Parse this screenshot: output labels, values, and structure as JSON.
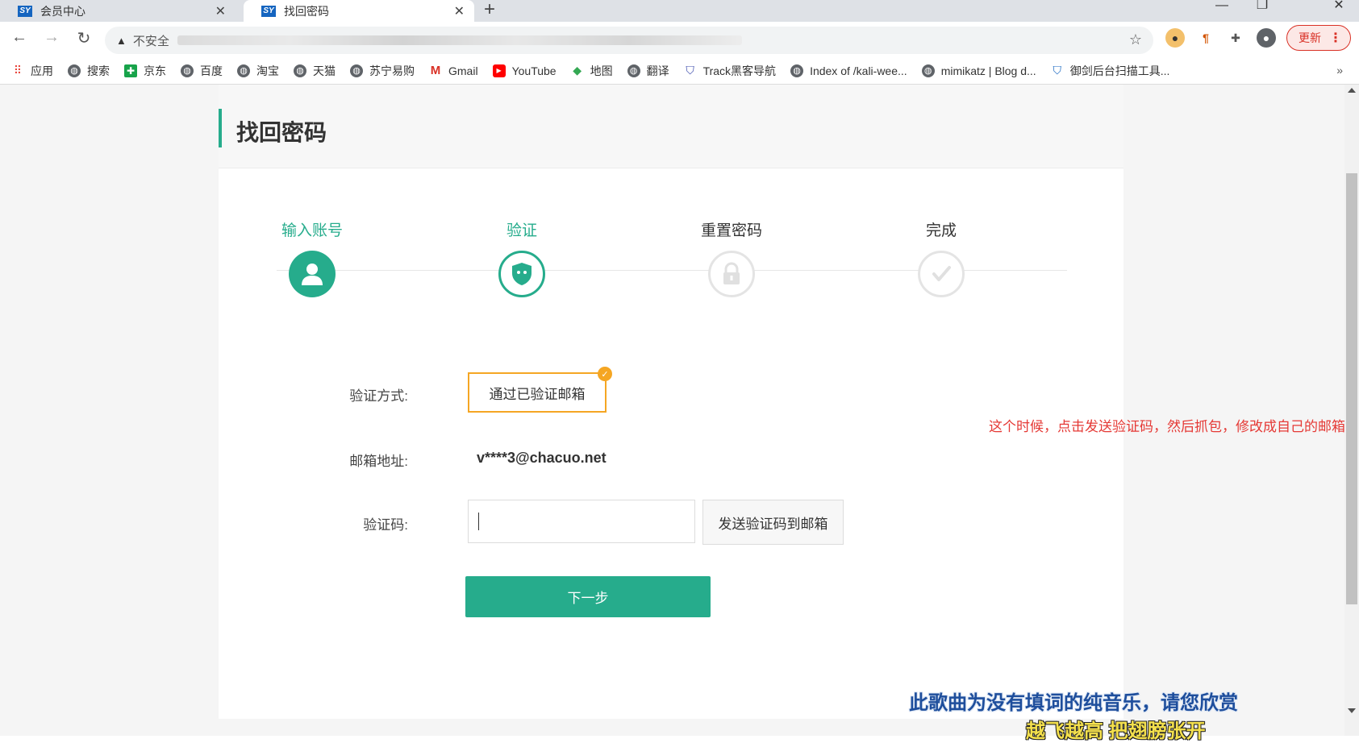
{
  "browser": {
    "tabs": [
      {
        "label": "会员中心",
        "favicon": "SY"
      },
      {
        "label": "找回密码",
        "favicon": "SY"
      }
    ],
    "new_tab_icon": "+",
    "window_controls": {
      "minimize": "—",
      "restore": "❐",
      "close": "✕"
    },
    "address": {
      "security_label": "不安全"
    },
    "update_label": "更新",
    "menu_icon": "⋮",
    "bookmarks": [
      {
        "label": "应用",
        "icon": "apps-grid-icon"
      },
      {
        "label": "搜索",
        "icon": "globe-icon"
      },
      {
        "label": "京东",
        "icon": "jd-icon"
      },
      {
        "label": "百度",
        "icon": "globe-icon"
      },
      {
        "label": "淘宝",
        "icon": "globe-icon"
      },
      {
        "label": "天猫",
        "icon": "globe-icon"
      },
      {
        "label": "苏宁易购",
        "icon": "globe-icon"
      },
      {
        "label": "Gmail",
        "icon": "gmail-icon"
      },
      {
        "label": "YouTube",
        "icon": "youtube-icon"
      },
      {
        "label": "地图",
        "icon": "maps-icon"
      },
      {
        "label": "翻译",
        "icon": "globe-icon"
      },
      {
        "label": "Track黑客导航",
        "icon": "shield-icon"
      },
      {
        "label": "Index of /kali-wee...",
        "icon": "globe-icon"
      },
      {
        "label": "mimikatz | Blog d...",
        "icon": "globe-icon"
      },
      {
        "label": "御剑后台扫描工具...",
        "icon": "shield-icon"
      }
    ],
    "more_bookmarks": "»"
  },
  "page": {
    "title": "找回密码",
    "steps": [
      {
        "label": "输入账号",
        "state": "done"
      },
      {
        "label": "验证",
        "state": "current"
      },
      {
        "label": "重置密码",
        "state": "pending"
      },
      {
        "label": "完成",
        "state": "pending"
      }
    ],
    "form": {
      "method_label": "验证方式:",
      "method_value": "通过已验证邮箱",
      "email_label": "邮箱地址:",
      "email_value": "v****3@chacuo.net",
      "code_label": "验证码:",
      "code_value": "",
      "send_button": "发送验证码到邮箱",
      "next_button": "下一步"
    },
    "annotation": "这个时候，点击发送验证码，然后抓包，修改成自己的邮箱"
  },
  "subtitles": {
    "line1": "此歌曲为没有填词的纯音乐，请您欣赏",
    "line2": "越飞越高 把翅膀张开"
  },
  "colors": {
    "accent": "#26ac8c",
    "selected_border": "#f5a623",
    "annotation": "#e53935"
  }
}
